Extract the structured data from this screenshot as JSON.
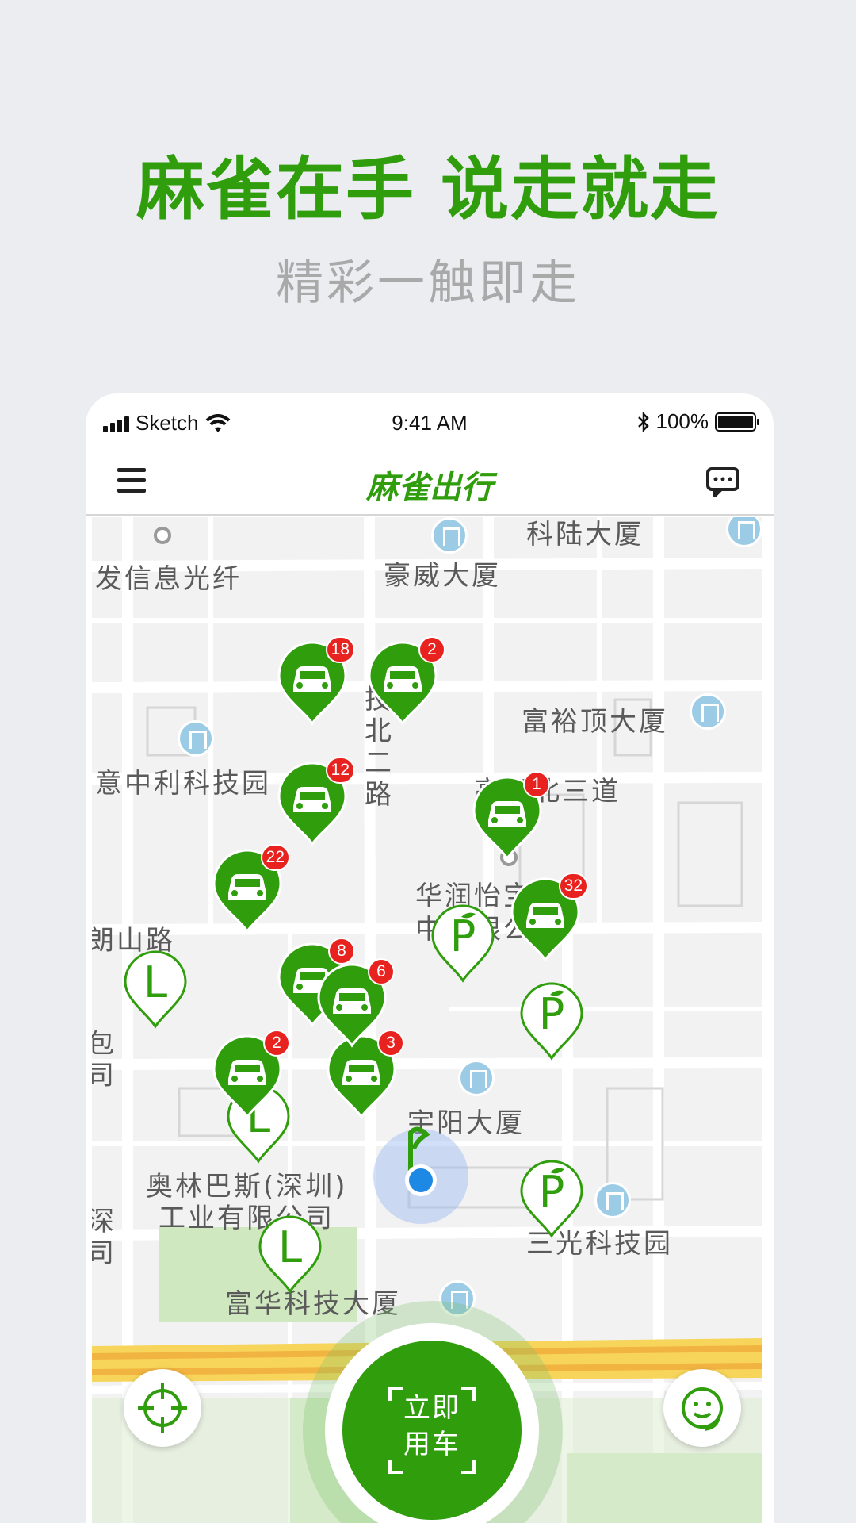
{
  "promo": {
    "title": "麻雀在手  说走就走",
    "subtitle": "精彩一触即走"
  },
  "statusbar": {
    "carrier": "Sketch",
    "time": "9:41 AM",
    "battery": "100%"
  },
  "navbar": {
    "brand": "麻雀出行"
  },
  "map": {
    "labels": [
      "科陆大厦",
      "发信息光纤",
      "豪威大厦",
      "富裕顶大厦",
      "意中利科技园",
      "高新北三道",
      "华润怡宝饮",
      "中有限公司",
      "朗山路",
      "包",
      "司",
      "宇阳大厦",
      "奥林巴斯(深圳)",
      "工业有限公司",
      "深",
      "司",
      "三光科技园",
      "富华科技大厦"
    ],
    "vertical_label": "技北二路",
    "car_counts": [
      "18",
      "2",
      "12",
      "1",
      "22",
      "32",
      "8",
      "6",
      "2",
      "3"
    ],
    "parking_letter": "P",
    "station_letter": "L"
  },
  "actions": {
    "go_button": [
      "立即",
      "用车"
    ]
  },
  "colors": {
    "brand_green": "#2f9d0c",
    "badge_red": "#e8231f",
    "background": "#ebedf0"
  },
  "icons": [
    "menu-icon",
    "message-icon",
    "car-icon",
    "locate-icon",
    "customer-service-icon",
    "wifi-icon",
    "bluetooth-icon",
    "battery-icon"
  ]
}
